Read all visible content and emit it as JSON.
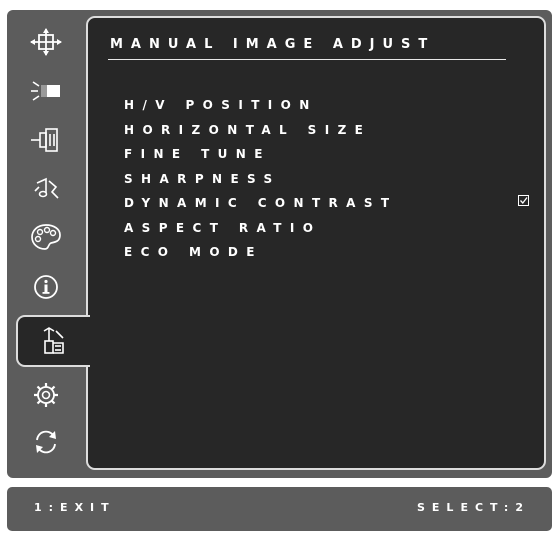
{
  "menu": {
    "title": "MANUAL IMAGE ADJUST",
    "items": [
      {
        "label": "H/V POSITION"
      },
      {
        "label": "HORIZONTAL SIZE"
      },
      {
        "label": "FINE TUNE"
      },
      {
        "label": "SHARPNESS"
      },
      {
        "label": "DYNAMIC CONTRAST",
        "checked": true
      },
      {
        "label": "ASPECT RATIO"
      },
      {
        "label": "ECO MODE"
      }
    ]
  },
  "sidebar": {
    "tabs": [
      {
        "icon": "input-select-icon"
      },
      {
        "icon": "brightness-icon"
      },
      {
        "icon": "connector-icon"
      },
      {
        "icon": "audio-icon"
      },
      {
        "icon": "color-palette-icon"
      },
      {
        "icon": "info-icon"
      },
      {
        "icon": "manual-adjust-icon",
        "active": true
      },
      {
        "icon": "setup-gear-icon"
      },
      {
        "icon": "memory-recall-icon"
      }
    ]
  },
  "footer": {
    "left": "1:EXIT",
    "right": "SELECT:2"
  }
}
